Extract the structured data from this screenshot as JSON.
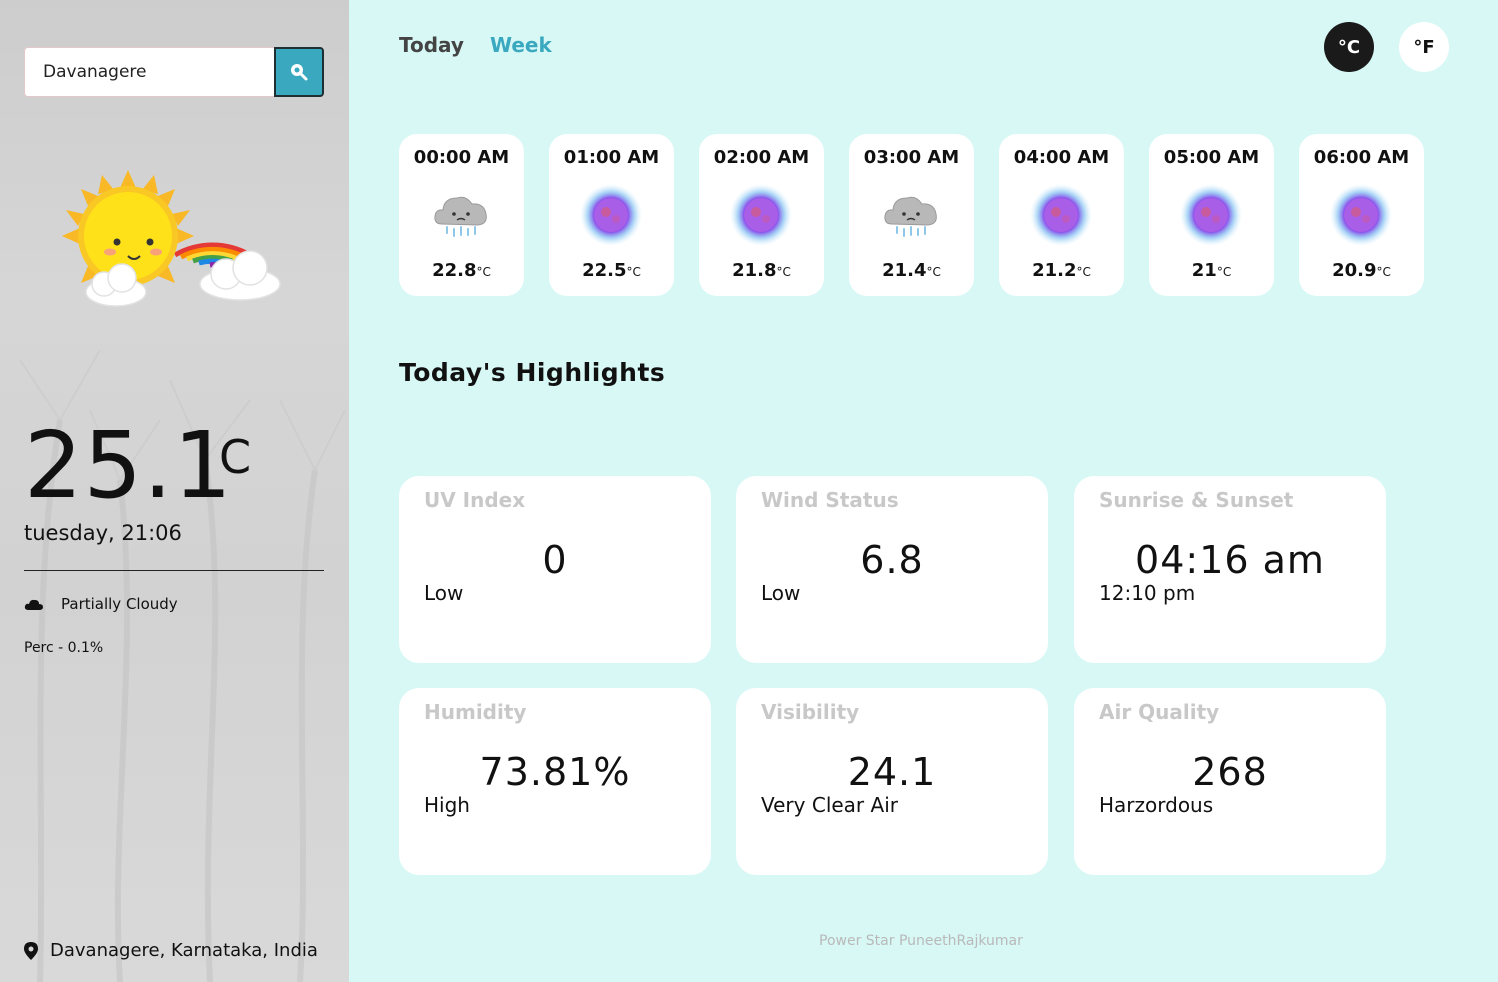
{
  "search": {
    "value": "Davanagere"
  },
  "current": {
    "temp": "25.1",
    "unit": "C",
    "datetime": "tuesday, 21:06",
    "condition": "Partially Cloudy",
    "precip": "Perc - 0.1%",
    "location": "Davanagere, Karnataka, India"
  },
  "tabs": {
    "today": "Today",
    "week": "Week"
  },
  "units": {
    "c": "°C",
    "f": "°F"
  },
  "hourly": [
    {
      "time": "00:00 AM",
      "temp": "22.8",
      "icon": "rain-cloud-icon"
    },
    {
      "time": "01:00 AM",
      "temp": "22.5",
      "icon": "moon-orb-icon"
    },
    {
      "time": "02:00 AM",
      "temp": "21.8",
      "icon": "moon-orb-icon"
    },
    {
      "time": "03:00 AM",
      "temp": "21.4",
      "icon": "rain-cloud-icon"
    },
    {
      "time": "04:00 AM",
      "temp": "21.2",
      "icon": "moon-orb-icon"
    },
    {
      "time": "05:00 AM",
      "temp": "21",
      "icon": "moon-orb-icon"
    },
    {
      "time": "06:00 AM",
      "temp": "20.9",
      "icon": "moon-orb-icon"
    }
  ],
  "hourly_unit": "°C",
  "highlights": {
    "title": "Today's Highlights",
    "uv": {
      "label": "UV Index",
      "value": "0",
      "status": "Low"
    },
    "wind": {
      "label": "Wind Status",
      "value": "6.8",
      "status": "Low"
    },
    "sun": {
      "label": "Sunrise & Sunset",
      "value": "04:16 am",
      "status": "12:10 pm"
    },
    "humidity": {
      "label": "Humidity",
      "value": "73.81%",
      "status": "High"
    },
    "visibility": {
      "label": "Visibility",
      "value": "24.1",
      "status": "Very Clear Air"
    },
    "air": {
      "label": "Air Quality",
      "value": "268",
      "status": "Harzordous"
    }
  },
  "footer": "Power Star PuneethRajkumar",
  "colors": {
    "accent": "#3aa9c0",
    "main_bg": "#d7f8f5",
    "sidebar_bg": "#d3d3d3"
  }
}
